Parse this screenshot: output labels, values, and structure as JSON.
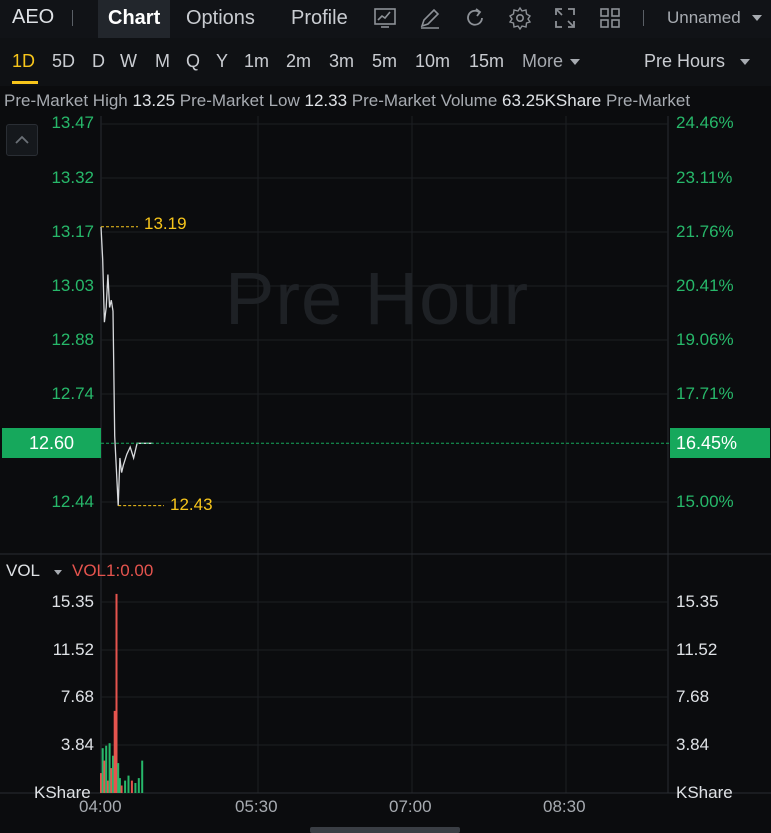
{
  "header": {
    "ticker": "AEO",
    "tabs": [
      {
        "label": "Chart",
        "active": true
      },
      {
        "label": "Options",
        "active": false
      },
      {
        "label": "Profile",
        "active": false
      }
    ],
    "tool_icons": [
      "chart-type-icon",
      "draw-pen-icon",
      "refresh-icon",
      "settings-gear-icon",
      "fullscreen-icon",
      "layout-grid-icon"
    ],
    "layout_name": "Unnamed"
  },
  "periods": {
    "items": [
      "1D",
      "5D",
      "D",
      "W",
      "M",
      "Q",
      "Y",
      "1m",
      "2m",
      "3m",
      "5m",
      "10m",
      "15m"
    ],
    "active": "1D",
    "more_label": "More",
    "session_label": "Pre Hours"
  },
  "stats": {
    "high_label": "Pre-Market High",
    "high_value": "13.25",
    "low_label": "Pre-Market Low",
    "low_value": "12.33",
    "volume_label": "Pre-Market Volume",
    "volume_value": "63.25KShare",
    "trailing_label": "Pre-Market"
  },
  "chart": {
    "watermark": "Pre Hour",
    "price_ticks": [
      "13.47",
      "13.32",
      "13.17",
      "13.03",
      "12.88",
      "12.74",
      "12.44"
    ],
    "pct_ticks": [
      "24.46%",
      "23.11%",
      "21.76%",
      "20.41%",
      "19.06%",
      "17.71%",
      "15.00%"
    ],
    "current_price": "12.60",
    "current_pct": "16.45%",
    "high_marker": "13.19",
    "low_marker": "12.43",
    "time_ticks": [
      "04:00",
      "05:30",
      "07:00",
      "08:30"
    ],
    "volume": {
      "title": "VOL",
      "indicator": "VOL1:0.00",
      "ticks": [
        "15.35",
        "11.52",
        "7.68",
        "3.84"
      ],
      "unit": "KShare"
    },
    "colors": {
      "up": "#27b86a",
      "down": "#e5544e",
      "accent": "#f7c51b",
      "line": "#d8dadd"
    }
  },
  "chart_data": {
    "type": "line",
    "title": "",
    "xlabel": "",
    "ylabel": "",
    "x_range": [
      "04:00",
      "09:30"
    ],
    "ylim": [
      12.33,
      13.47
    ],
    "price_series": [
      {
        "t": "04:00",
        "v": 13.19
      },
      {
        "t": "04:01",
        "v": 13.1
      },
      {
        "t": "04:02",
        "v": 12.93
      },
      {
        "t": "04:03",
        "v": 12.97
      },
      {
        "t": "04:04",
        "v": 13.06
      },
      {
        "t": "04:05",
        "v": 12.97
      },
      {
        "t": "04:06",
        "v": 12.99
      },
      {
        "t": "04:07",
        "v": 12.96
      },
      {
        "t": "04:08",
        "v": 12.62
      },
      {
        "t": "04:10",
        "v": 12.43
      },
      {
        "t": "04:11",
        "v": 12.56
      },
      {
        "t": "04:12",
        "v": 12.52
      },
      {
        "t": "04:13",
        "v": 12.54
      },
      {
        "t": "04:15",
        "v": 12.57
      },
      {
        "t": "04:17",
        "v": 12.59
      },
      {
        "t": "04:19",
        "v": 12.56
      },
      {
        "t": "04:21",
        "v": 12.6
      },
      {
        "t": "04:24",
        "v": 12.6
      },
      {
        "t": "04:30",
        "v": 12.6
      }
    ],
    "volume_series": [
      {
        "t": "04:00",
        "v": 1.6,
        "dir": "down"
      },
      {
        "t": "04:01",
        "v": 3.6,
        "dir": "up"
      },
      {
        "t": "04:02",
        "v": 2.6,
        "dir": "down"
      },
      {
        "t": "04:03",
        "v": 3.8,
        "dir": "up"
      },
      {
        "t": "04:04",
        "v": 1.0,
        "dir": "down"
      },
      {
        "t": "04:05",
        "v": 4.0,
        "dir": "up"
      },
      {
        "t": "04:06",
        "v": 2.0,
        "dir": "down"
      },
      {
        "t": "04:07",
        "v": 3.0,
        "dir": "up"
      },
      {
        "t": "04:08",
        "v": 6.6,
        "dir": "down"
      },
      {
        "t": "04:09",
        "v": 16.0,
        "dir": "down"
      },
      {
        "t": "04:10",
        "v": 2.4,
        "dir": "up"
      },
      {
        "t": "04:11",
        "v": 1.2,
        "dir": "up"
      },
      {
        "t": "04:12",
        "v": 0.6,
        "dir": "down"
      },
      {
        "t": "04:14",
        "v": 1.0,
        "dir": "up"
      },
      {
        "t": "04:16",
        "v": 1.4,
        "dir": "up"
      },
      {
        "t": "04:18",
        "v": 1.0,
        "dir": "down"
      },
      {
        "t": "04:20",
        "v": 0.8,
        "dir": "up"
      },
      {
        "t": "04:22",
        "v": 1.2,
        "dir": "up"
      },
      {
        "t": "04:24",
        "v": 2.6,
        "dir": "up"
      }
    ],
    "vol_ylim": [
      0,
      17.5
    ],
    "grid": true,
    "legend": "none"
  }
}
